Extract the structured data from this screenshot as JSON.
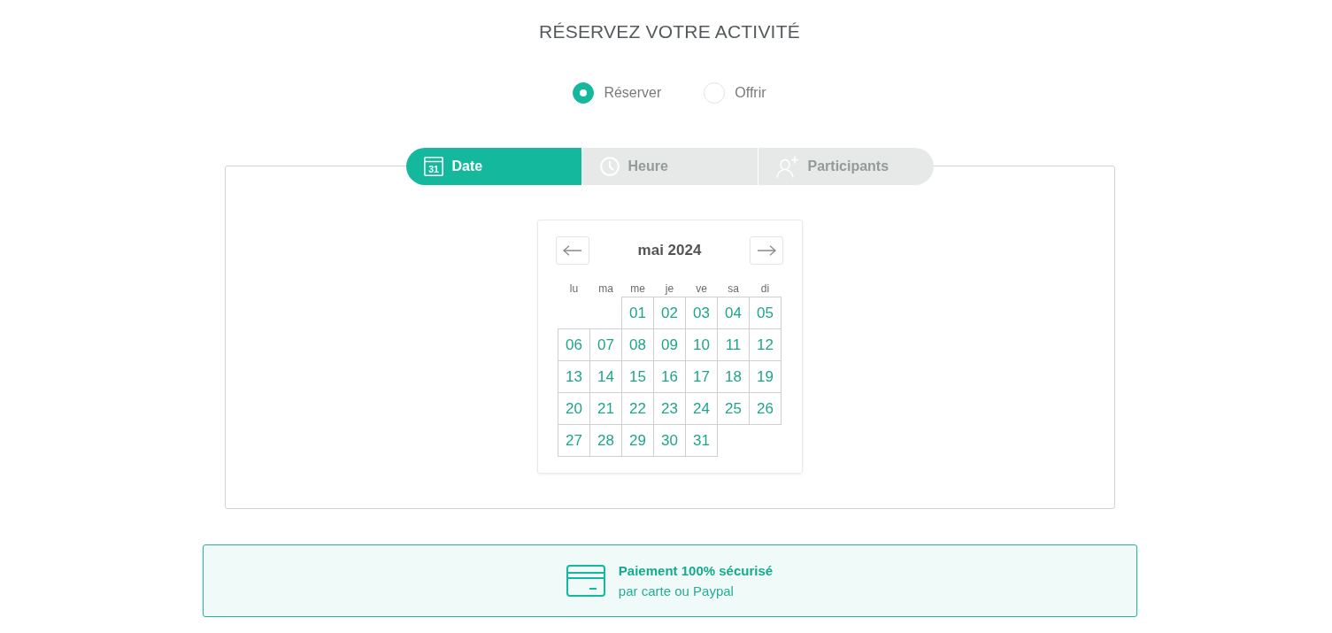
{
  "title": "RÉSERVEZ VOTRE ACTIVITÉ",
  "modes": [
    {
      "label": "Réserver",
      "selected": true
    },
    {
      "label": "Offrir",
      "selected": false
    }
  ],
  "steps": [
    {
      "kind": "calendar",
      "icon_text": "31",
      "label": "Date",
      "selected": true
    },
    {
      "kind": "clock",
      "label": "Heure",
      "selected": false
    },
    {
      "kind": "person-add",
      "label": "Participants",
      "selected": false
    }
  ],
  "calendar": {
    "month": "mai 2024",
    "weekdays": [
      "lu",
      "ma",
      "me",
      "je",
      "ve",
      "sa",
      "di"
    ],
    "weeks": [
      [
        "01",
        "02",
        "03",
        "04",
        "05"
      ],
      [
        "06",
        "07",
        "08",
        "09",
        "10",
        "11",
        "12"
      ],
      [
        "13",
        "14",
        "15",
        "16",
        "17",
        "18",
        "19"
      ],
      [
        "20",
        "21",
        "22",
        "23",
        "24",
        "25",
        "26"
      ],
      [
        "27",
        "28",
        "29",
        "30",
        "31"
      ]
    ]
  },
  "payment": {
    "title": "Paiement 100% sécurisé",
    "subtitle": "par carte ou Paypal"
  }
}
